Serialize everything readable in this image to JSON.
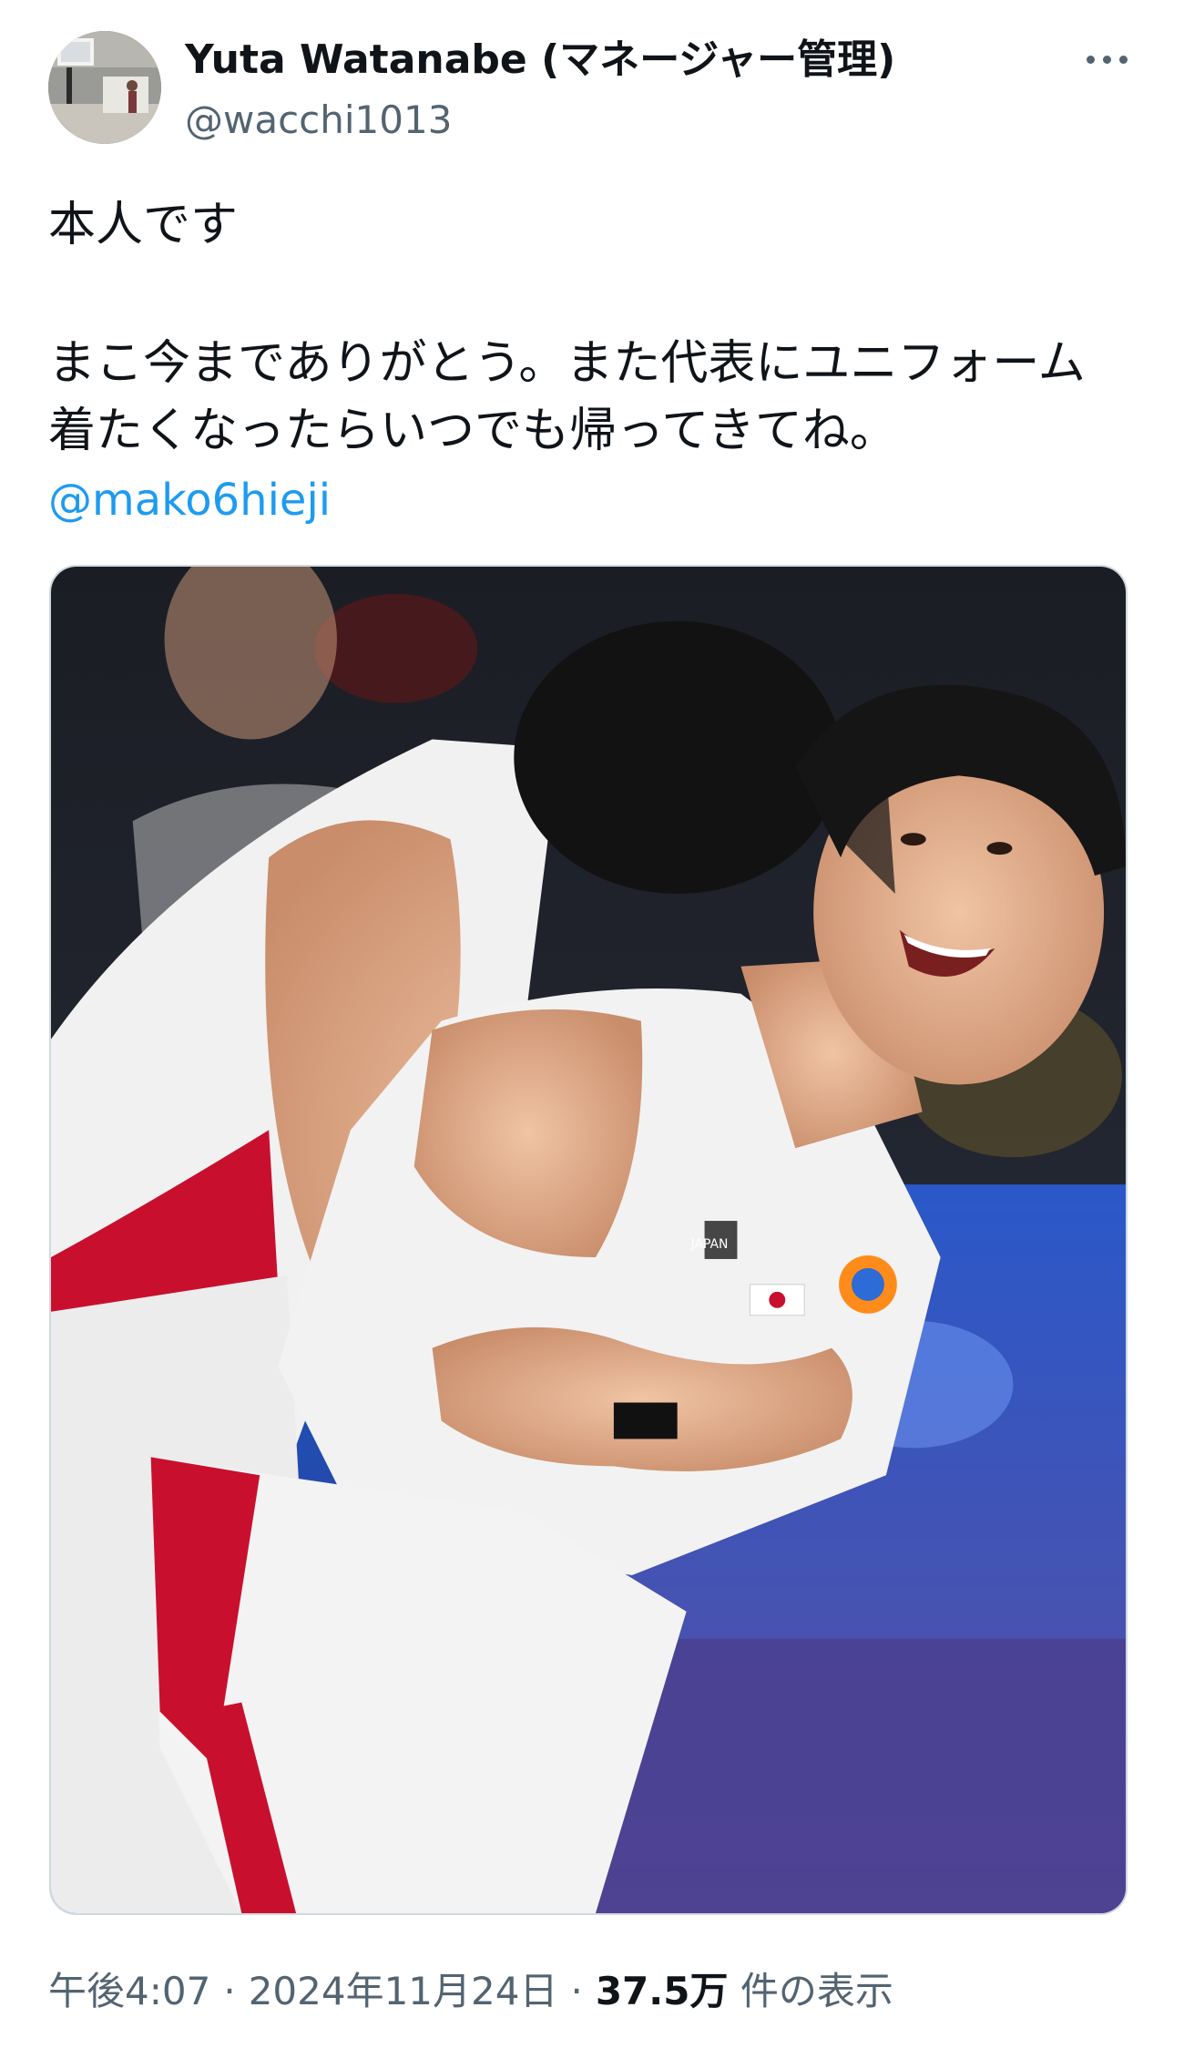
{
  "author": {
    "name": "Yuta Watanabe (マネージャー管理)",
    "handle": "@wacchi1013",
    "avatar_icon": "user-avatar"
  },
  "menu": {
    "more_icon": "more-horizontal-icon"
  },
  "tweet": {
    "line1": "本人です",
    "line2": "まこ今までありがとう。また代表にユニフォーム",
    "line3": "着たくなったらいつでも帰ってきてね。",
    "mention": "@mako6hieji"
  },
  "media": {
    "kind": "photo",
    "jersey_text": "JAPAN"
  },
  "footer": {
    "time": "午後4:07",
    "separator": "·",
    "date": "2024年11月24日",
    "views_count": "37.5万",
    "views_label": "件の表示"
  },
  "colors": {
    "text_primary": "#0f1419",
    "text_secondary": "#536471",
    "link": "#1d9bf0",
    "border": "#cfd9de"
  }
}
